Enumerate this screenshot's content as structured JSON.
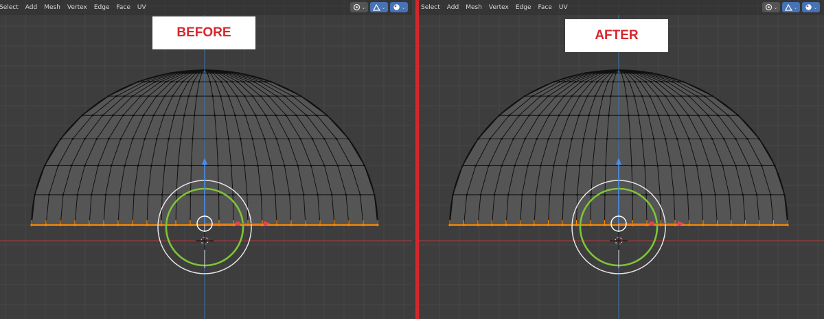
{
  "before_panel": {
    "menu": [
      "Select",
      "Add",
      "Mesh",
      "Vertex",
      "Edge",
      "Face",
      "UV"
    ],
    "label": "BEFORE"
  },
  "after_panel": {
    "menu": [
      "Select",
      "Add",
      "Mesh",
      "Vertex",
      "Edge",
      "Face",
      "UV"
    ],
    "label": "AFTER"
  },
  "header_tools": [
    {
      "icon": "snap-icon"
    },
    {
      "icon": "proportional-editing-icon"
    },
    {
      "icon": "viewport-shading-icon"
    }
  ],
  "colors": {
    "background": "#3d3d3d",
    "grid": "#484848",
    "x_axis": "#9c3a3f",
    "z_axis": "#3e6e9e",
    "wire": "#111111",
    "selected": "#ff8a00",
    "gizmo_ring": "#7fc437",
    "gizmo_x": "#e84155",
    "gizmo_y": "#91d44b",
    "gizmo_z": "#4b8dea",
    "divider": "#d6262c",
    "label_text": "#d8262d"
  }
}
